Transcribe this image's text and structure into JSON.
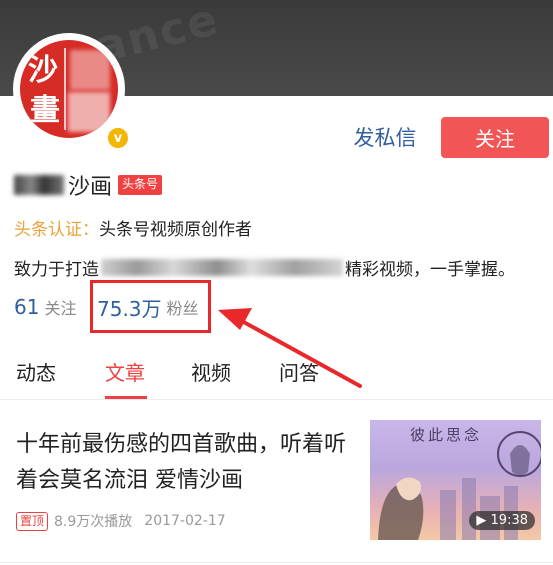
{
  "profile": {
    "name": "沙画",
    "name_tag": "头条号",
    "cert_label": "头条认证：",
    "cert_text": "头条号视频原创作者",
    "bio_prefix": "致力于打造",
    "bio_suffix": "精彩视频，一手掌握。",
    "avatar_chars": [
      "沙",
      "畫"
    ],
    "verified_icon": "v"
  },
  "actions": {
    "message_label": "发私信",
    "follow_label": "关注"
  },
  "stats": {
    "following_count": "61",
    "following_label": "关注",
    "fans_count": "75.3万",
    "fans_label": "粉丝"
  },
  "tabs": [
    {
      "label": "动态",
      "active": false
    },
    {
      "label": "文章",
      "active": true
    },
    {
      "label": "视频",
      "active": false
    },
    {
      "label": "问答",
      "active": false
    }
  ],
  "article": {
    "title": "十年前最伤感的四首歌曲，听着听着会莫名流泪 爱情沙画",
    "pin_label": "置顶",
    "plays": "8.9万次播放",
    "date": "2017-02-17",
    "duration": "▶ 19:38",
    "thumbnail_text": "彼此思念"
  },
  "colors": {
    "accent": "#f04142",
    "link_blue": "#2f5f9e",
    "cert_orange": "#e8a33a",
    "annotation_red": "#e8282b"
  }
}
